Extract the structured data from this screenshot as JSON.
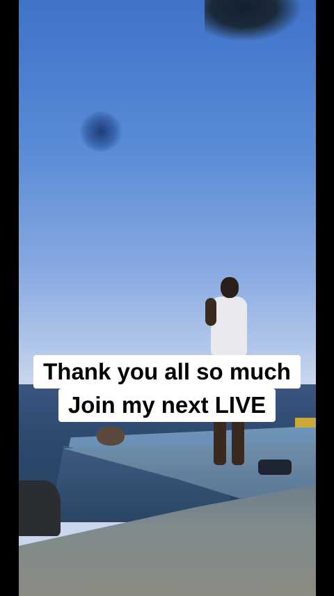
{
  "caption": {
    "line1": "Thank you all so much",
    "line2": "Join my next LIVE"
  },
  "colors": {
    "sky_top": "#3f73c9",
    "sky_horizon": "#c9d6ec",
    "sea": "#2d4a70",
    "caption_bg": "#ffffff",
    "caption_text": "#000000"
  }
}
